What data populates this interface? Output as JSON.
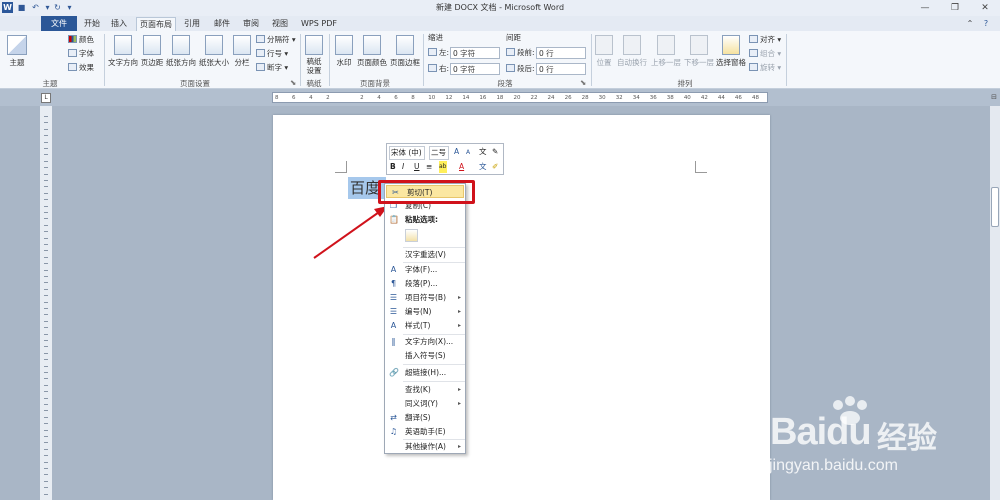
{
  "window": {
    "title": "新建 DOCX 文档 - Microsoft Word",
    "logo_letter": "W",
    "minimize": "—",
    "maximize": "❐",
    "close": "✕"
  },
  "tabs": [
    "文件",
    "开始",
    "插入",
    "页面布局",
    "引用",
    "邮件",
    "审阅",
    "视图",
    "WPS PDF"
  ],
  "active_tab": "页面布局",
  "ribbon": {
    "theme": {
      "themes": "主题",
      "colors": "颜色",
      "fonts": "字体",
      "effects": "效果",
      "group": "主题"
    },
    "page_setup": {
      "text_direction": "文字方向",
      "margins": "页边距",
      "orientation": "纸张方向",
      "size": "纸张大小",
      "columns": "分栏",
      "breaks": "分隔符",
      "line_numbers": "行号",
      "hyphenation": "断字",
      "group": "页面设置"
    },
    "draft": {
      "label": "稿纸设置",
      "group": "稿纸"
    },
    "page_background": {
      "watermark": "水印",
      "page_color": "页面颜色",
      "page_border": "页面边框",
      "group": "页面背景"
    },
    "indent": {
      "title": "缩进",
      "left_label": "左:",
      "left_value": "0 字符",
      "right_label": "右:",
      "right_value": "0 字符"
    },
    "spacing": {
      "title": "间距",
      "before_label": "段前:",
      "before_value": "0 行",
      "after_label": "段后:",
      "after_value": "0 行"
    },
    "paragraph_group": "段落",
    "arrange": {
      "position": "位置",
      "wrap": "自动换行",
      "forward": "上移一层",
      "backward": "下移一层",
      "selection_pane": "选择窗格",
      "align": "对齐",
      "group_btn": "组合",
      "rotate": "旋转",
      "group": "排列"
    }
  },
  "ruler": {
    "ticks": [
      "8",
      "6",
      "4",
      "2",
      "",
      "2",
      "4",
      "6",
      "8",
      "10",
      "12",
      "14",
      "16",
      "18",
      "20",
      "22",
      "24",
      "26",
      "28",
      "30",
      "32",
      "34",
      "36",
      "38",
      "40",
      "42",
      "44",
      "46",
      "48"
    ]
  },
  "document": {
    "selected_text": "百度"
  },
  "mini_toolbar": {
    "font": "宋体 (中)",
    "size": "二号",
    "grow": "A",
    "shrink": "A",
    "format_painter": "✎",
    "bold": "B",
    "italic": "I",
    "underline": "U",
    "center": "≡",
    "highlight": "ab",
    "font_color": "A",
    "phonetic": "文",
    "clear": "✐"
  },
  "context_menu": {
    "items": [
      {
        "label": "剪切(T)",
        "icon": "✂"
      },
      {
        "label": "复制(C)",
        "icon": "❐"
      },
      {
        "label": "粘贴选项:",
        "icon": "📋"
      },
      {
        "label": "汉字重选(V)",
        "icon": ""
      },
      {
        "label": "字体(F)...",
        "icon": "A"
      },
      {
        "label": "段落(P)...",
        "icon": "¶"
      },
      {
        "label": "项目符号(B)",
        "icon": "☰",
        "submenu": true
      },
      {
        "label": "编号(N)",
        "icon": "☰",
        "submenu": true
      },
      {
        "label": "样式(T)",
        "icon": "A",
        "submenu": true
      },
      {
        "label": "文字方向(X)...",
        "icon": "‖"
      },
      {
        "label": "插入符号(S)",
        "icon": ""
      },
      {
        "label": "超链接(H)...",
        "icon": "🔗"
      },
      {
        "label": "查找(K)",
        "icon": "",
        "submenu": true
      },
      {
        "label": "同义词(Y)",
        "icon": "",
        "submenu": true
      },
      {
        "label": "翻译(S)",
        "icon": "⇄"
      },
      {
        "label": "英语助手(E)",
        "icon": "♫"
      },
      {
        "label": "其他操作(A)",
        "icon": "",
        "submenu": true
      }
    ],
    "submenu_arrow": "▸"
  },
  "watermark": {
    "brand": "Bai",
    "brand2": "du",
    "brand_cn": "经验",
    "url": "jingyan.baidu.com"
  },
  "colors": {
    "accent": "#2b5797",
    "highlight": "#d0121b",
    "selection": "#a6c8ec",
    "arrow": "#d0121b"
  }
}
